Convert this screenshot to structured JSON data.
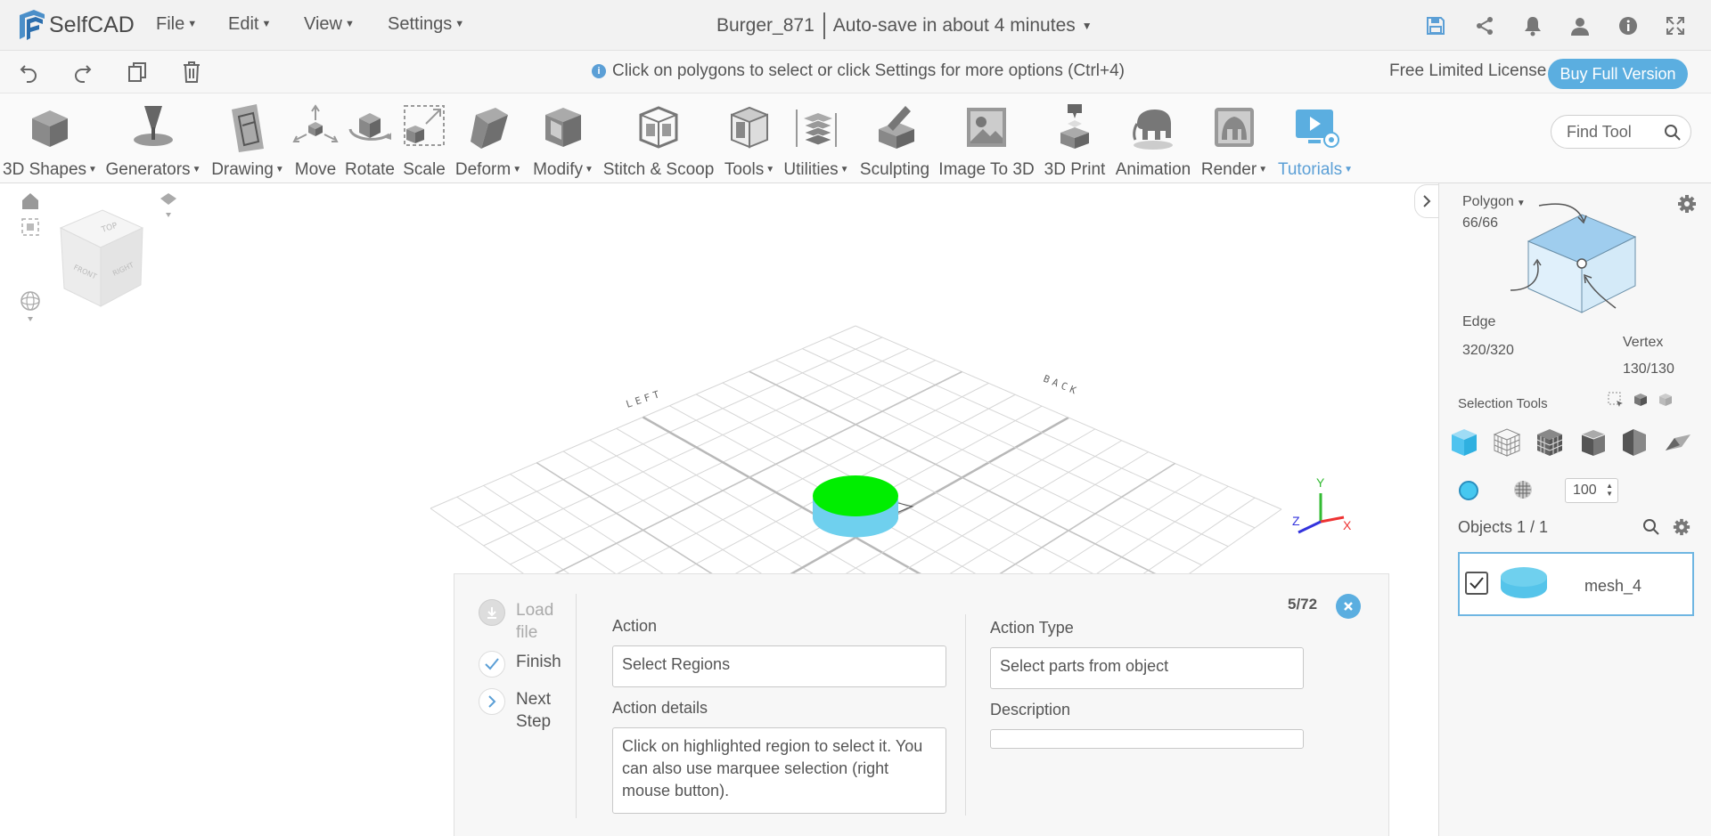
{
  "app": {
    "name": "SelfCAD"
  },
  "menu": [
    "File",
    "Edit",
    "View",
    "Settings"
  ],
  "document": {
    "title": "Burger_871",
    "autosave": "Auto-save in about 4 minutes"
  },
  "top_icons": [
    "save-icon",
    "share-icon",
    "bell-icon",
    "user-icon",
    "info-icon",
    "fullscreen-icon"
  ],
  "infobar": {
    "hint": "Click on polygons to select or click Settings for more options (Ctrl+4)",
    "license": "Free Limited License",
    "buy_label": "Buy Full Version"
  },
  "history_icons": [
    "undo-icon",
    "redo-icon",
    "copy-icon",
    "delete-icon"
  ],
  "toolbar": {
    "tools": [
      {
        "label": "3D Shapes",
        "dropdown": true
      },
      {
        "label": "Generators",
        "dropdown": true
      },
      {
        "label": "Drawing",
        "dropdown": true
      },
      {
        "label": "Move",
        "dropdown": false
      },
      {
        "label": "Rotate",
        "dropdown": false
      },
      {
        "label": "Scale",
        "dropdown": false
      },
      {
        "label": "Deform",
        "dropdown": true
      },
      {
        "label": "Modify",
        "dropdown": true
      },
      {
        "label": "Stitch & Scoop",
        "dropdown": false
      },
      {
        "label": "Tools",
        "dropdown": true
      },
      {
        "label": "Utilities",
        "dropdown": true
      },
      {
        "label": "Sculpting",
        "dropdown": false
      },
      {
        "label": "Image To 3D",
        "dropdown": false
      },
      {
        "label": "3D Print",
        "dropdown": false
      },
      {
        "label": "Animation",
        "dropdown": false
      },
      {
        "label": "Render",
        "dropdown": true
      },
      {
        "label": "Tutorials",
        "dropdown": true
      }
    ],
    "find_placeholder": "Find Tool"
  },
  "viewport": {
    "cube_faces": [
      "TOP",
      "FRONT",
      "RIGHT"
    ],
    "grid_labels": [
      "LEFT",
      "BACK"
    ],
    "axes": [
      "Y",
      "Z",
      "X"
    ],
    "colors": {
      "object_top": "#00ee00",
      "object_side": "#6fd0ee",
      "axis_x": "#e33",
      "axis_y": "#3b3",
      "axis_z": "#33d"
    }
  },
  "selection_panel": {
    "polygon_label": "Polygon",
    "polygon_count": "66/66",
    "edge_label": "Edge",
    "edge_count": "320/320",
    "vertex_label": "Vertex",
    "vertex_count": "130/130",
    "selection_tools_label": "Selection Tools",
    "brush_size": "100",
    "objects_label": "Objects 1 / 1",
    "objects": [
      {
        "name": "mesh_4",
        "checked": true
      }
    ]
  },
  "tutorial": {
    "steps": [
      {
        "label": "Load file",
        "state": "disabled"
      },
      {
        "label": "Finish",
        "state": "done"
      },
      {
        "label": "Next Step",
        "state": "next"
      }
    ],
    "counter": "5/72",
    "action_label": "Action",
    "action_value": "Select Regions",
    "action_details_label": "Action details",
    "action_details": "Click on highlighted region to select it. You can also use marquee selection (right mouse button).",
    "action_type_label": "Action Type",
    "action_type_value": "Select parts from object",
    "description_label": "Description",
    "description_value": ""
  }
}
